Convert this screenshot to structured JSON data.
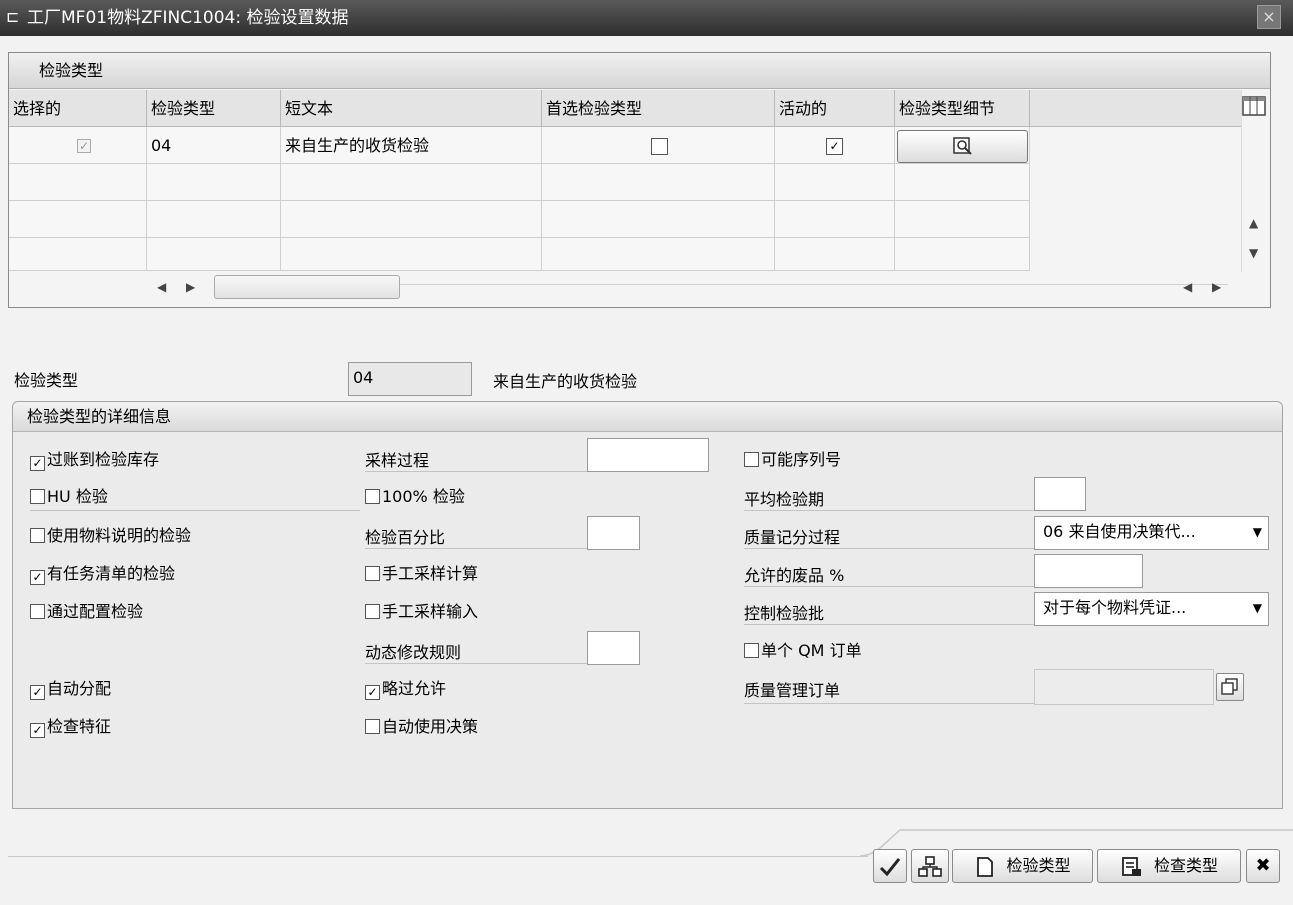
{
  "window": {
    "title": "工厂MF01物料ZFINC1004: 检验设置数据",
    "close_label": "×"
  },
  "table": {
    "title": "检验类型",
    "columns": [
      "选择的",
      "检验类型",
      "短文本",
      "首选检验类型",
      "活动的",
      "检验类型细节"
    ],
    "rows": [
      {
        "selected": true,
        "insp_type": "04",
        "short_text": "来自生产的收货检验",
        "preferred": false,
        "active": true
      }
    ]
  },
  "header": {
    "insp_type_label": "检验类型",
    "insp_type_value": "04",
    "insp_type_text": "来自生产的收货检验"
  },
  "details": {
    "title": "检验类型的详细信息",
    "col1": [
      {
        "label": "过账到检验库存",
        "checked": true
      },
      {
        "label": "HU 检验",
        "checked": false
      },
      {
        "label": "使用物料说明的检验",
        "checked": false
      },
      {
        "label": "有任务清单的检验",
        "checked": true
      },
      {
        "label": "通过配置检验",
        "checked": false
      },
      {
        "label": "自动分配",
        "checked": true
      },
      {
        "label": "检查特征",
        "checked": true
      }
    ],
    "col2": {
      "sampling_procedure_label": "采样过程",
      "sampling_procedure_value": "",
      "check_100_label": "100% 检验",
      "check_100": false,
      "insp_percent_label": "检验百分比",
      "insp_percent_value": "",
      "manual_sample_calc_label": "手工采样计算",
      "manual_sample_calc": false,
      "manual_sample_entry_label": "手工采样输入",
      "manual_sample_entry": false,
      "dyn_mod_rule_label": "动态修改规则",
      "dyn_mod_rule_value": "",
      "skip_allowed_label": "略过允许",
      "skip_allowed": true,
      "auto_ud_label": "自动使用决策",
      "auto_ud": false
    },
    "col3": {
      "serial_possible_label": "可能序列号",
      "serial_possible": false,
      "avg_insp_duration_label": "平均检验期",
      "avg_insp_duration_value": "",
      "qscore_proc_label": "质量记分过程",
      "qscore_proc_value": "06 来自使用决策代...",
      "allowed_scrap_label": "允许的废品 %",
      "allowed_scrap_value": "",
      "control_lot_label": "控制检验批",
      "control_lot_value": "对于每个物料凭证...",
      "single_qm_order_label": "单个 QM 订单",
      "single_qm_order": false,
      "qm_order_label": "质量管理订单",
      "qm_order_value": ""
    }
  },
  "footer": {
    "insp_type_btn": "检验类型",
    "check_type_btn": "检查类型"
  },
  "glyphs": {
    "check": "✓",
    "caret_down": "▼",
    "arrow_left": "◀",
    "arrow_right": "▶",
    "arrow_up": "▲",
    "arrow_down": "▼",
    "close": "✖"
  }
}
